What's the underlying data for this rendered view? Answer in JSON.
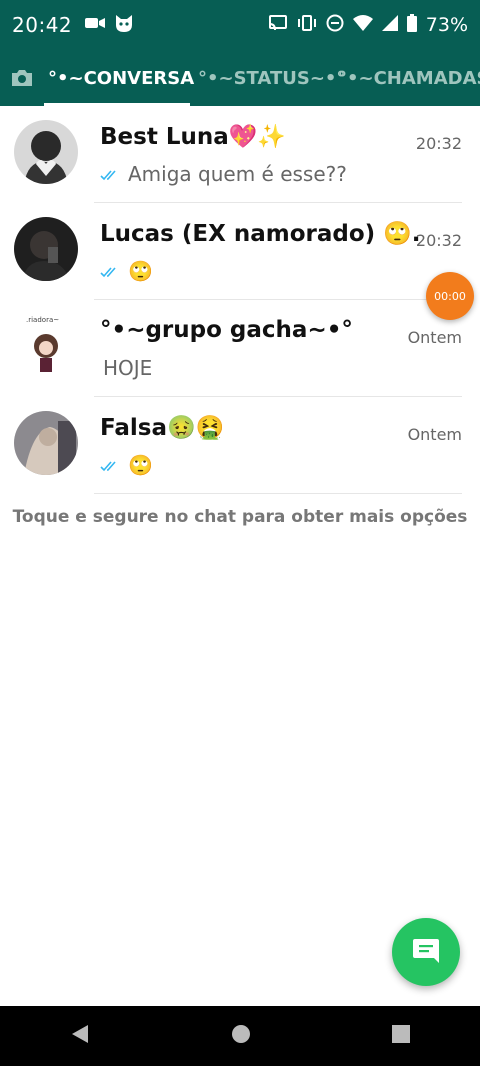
{
  "status_bar": {
    "time": "20:42",
    "battery": "73%",
    "icons": [
      "video-camera-icon",
      "cat-face-icon",
      "cast-icon",
      "vibrate-icon",
      "do-not-disturb-icon",
      "wifi-icon",
      "cellular-signal-icon",
      "battery-icon"
    ]
  },
  "tabs": {
    "camera_icon": "camera-icon",
    "items": [
      {
        "label": "°•~CONVERSA",
        "active": true
      },
      {
        "label": "°•~STATUS~•°",
        "active": false
      },
      {
        "label": "°•~CHAMADAS",
        "active": false
      }
    ]
  },
  "chats": [
    {
      "name": "Best Luna💖✨",
      "time": "20:32",
      "message": "Amiga quem é esse??",
      "read": true
    },
    {
      "name": "Lucas (EX namorado) 🙄...",
      "time": "20:32",
      "message": "🙄",
      "read": true
    },
    {
      "name": "°•~grupo gacha~•°",
      "time": "Ontem",
      "message": "HOJE",
      "read": false
    },
    {
      "name": "Falsa🤢🤮",
      "time": "Ontem",
      "message": "🙄",
      "read": true
    }
  ],
  "hint": "Toque e segure no chat para obter mais opções",
  "recording_timer": "00:00",
  "avatar_caption": ".riadora~",
  "fab_icon": "new-chat-icon",
  "colors": {
    "header": "#075e54",
    "fab": "#25c462",
    "read_ticks": "#34b7f1",
    "timer": "#f27c1c"
  },
  "navigation": {
    "icons": [
      "back-icon",
      "home-icon",
      "recents-icon"
    ]
  }
}
